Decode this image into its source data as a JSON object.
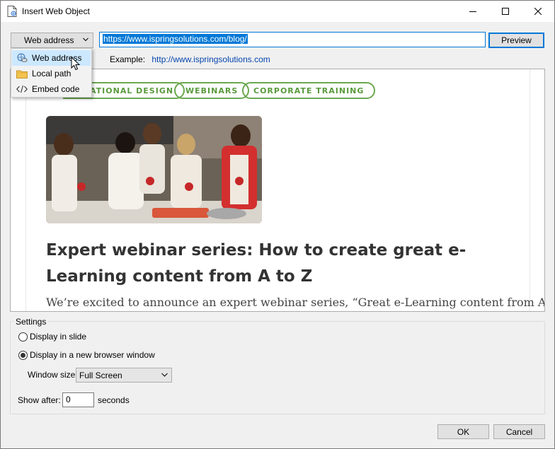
{
  "window": {
    "title": "Insert Web Object"
  },
  "address": {
    "type_label": "Web address",
    "url_value": "https://www.ispringsolutions.com/blog/",
    "preview_label": "Preview",
    "example_label": "Example:",
    "example_url": "http://www.ispringsolutions.com"
  },
  "menu": {
    "items": [
      {
        "label": "Web address",
        "icon": "web-link-icon"
      },
      {
        "label": "Local path",
        "icon": "folder-icon"
      },
      {
        "label": "Embed code",
        "icon": "code-icon"
      }
    ]
  },
  "preview_page": {
    "chips": [
      "ATIONAL DESIGN",
      "WEBINARS",
      "CORPORATE TRAINING"
    ],
    "headline": "Expert webinar series: How to create great e-Learning content from A to Z",
    "paragraph": "We’re excited to announce an expert webinar series, “Great e-Learning content from A to Z”.",
    "accent_color": "#6aa84f"
  },
  "settings": {
    "legend": "Settings",
    "display_in_slide": "Display in slide",
    "display_in_browser": "Display in a new browser window",
    "selected_option": "Display in a new browser window",
    "window_size_label": "Window size:",
    "window_size_value": "Full Screen",
    "show_after_label": "Show after:",
    "show_after_value": "0",
    "seconds_label": "seconds"
  },
  "buttons": {
    "ok": "OK",
    "cancel": "Cancel"
  }
}
